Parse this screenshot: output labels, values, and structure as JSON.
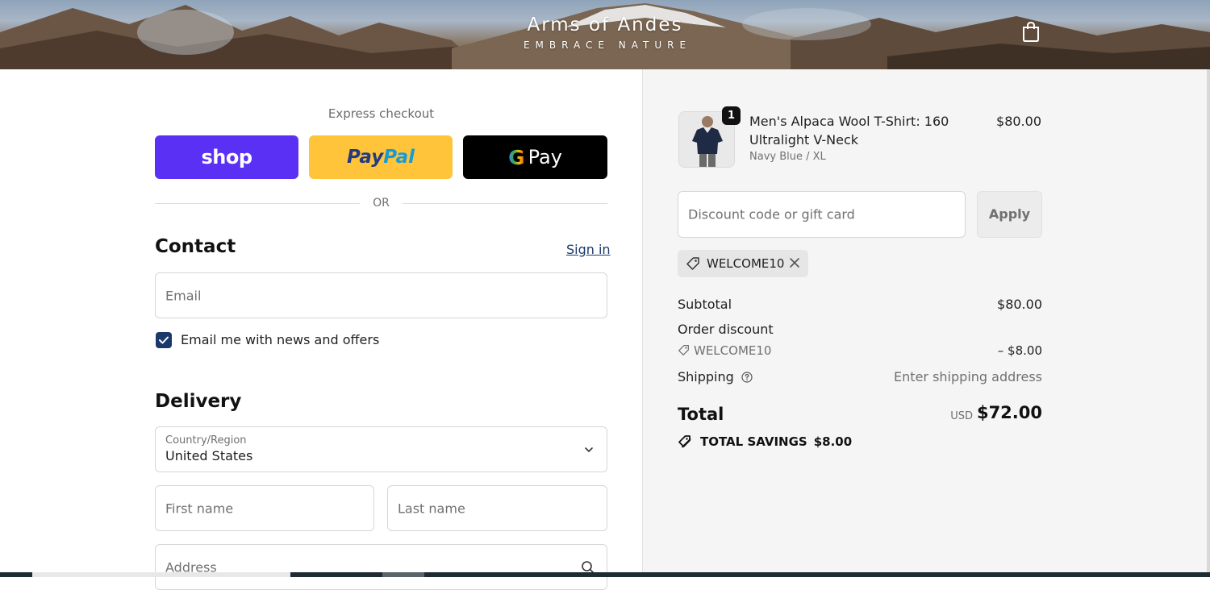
{
  "header": {
    "logo_name": "Arms of Andes",
    "logo_tagline": "EMBRACE NATURE",
    "cart_icon": "shopping-bag-icon"
  },
  "express": {
    "label": "Express checkout",
    "shop_label": "shop",
    "paypal_label_1": "Pay",
    "paypal_label_2": "Pal",
    "gpay_g": "G",
    "gpay_label": "Pay",
    "or": "OR"
  },
  "contact": {
    "title": "Contact",
    "sign_in": "Sign in",
    "email_placeholder": "Email",
    "newsletter_label": "Email me with news and offers",
    "newsletter_checked": true
  },
  "delivery": {
    "title": "Delivery",
    "country_label": "Country/Region",
    "country_value": "United States",
    "first_name_placeholder": "First name",
    "last_name_placeholder": "Last name",
    "address_placeholder": "Address"
  },
  "summary": {
    "product": {
      "quantity": "1",
      "name": "Men's Alpaca Wool T-Shirt: 160 Ultralight V-Neck",
      "variant": "Navy Blue / XL",
      "price": "$80.00"
    },
    "discount_placeholder": "Discount code or gift card",
    "apply_label": "Apply",
    "applied_code": "WELCOME10",
    "subtotal_label": "Subtotal",
    "subtotal_value": "$80.00",
    "order_discount_label": "Order discount",
    "discount_code": "WELCOME10",
    "discount_value": "– $8.00",
    "shipping_label": "Shipping",
    "shipping_value": "Enter shipping address",
    "total_label": "Total",
    "total_currency": "USD",
    "total_value": "$72.00",
    "savings_label": "TOTAL SAVINGS",
    "savings_value": "$8.00"
  },
  "colors": {
    "shop_purple": "#5a31f4",
    "paypal_yellow": "#ffc439",
    "checkbox_blue": "#1b3a6b",
    "summary_bg": "#f5f5f5"
  }
}
